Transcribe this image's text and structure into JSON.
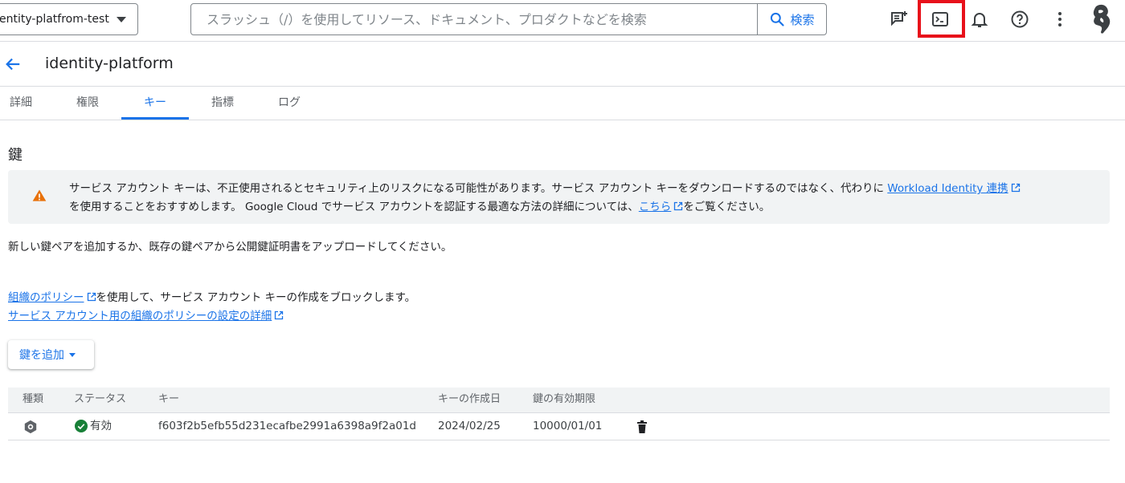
{
  "topbar": {
    "project_name": "entity-platfrom-test",
    "search_placeholder": "スラッシュ（/）を使用してリソース、ドキュメント、プロダクトなどを検索",
    "search_button": "検索"
  },
  "icons": {
    "feedback": "feedback-icon",
    "cloud_shell": "cloud-shell-terminal-icon",
    "notifications": "bell-icon",
    "help": "help-icon",
    "more": "more-vert-icon"
  },
  "colors": {
    "accent": "#1a73e8",
    "highlight": "#e8111a",
    "warning": "#e8710a",
    "status_ok": "#188038"
  },
  "header": {
    "title": "identity-platform"
  },
  "tabs": [
    {
      "label": "詳細"
    },
    {
      "label": "権限"
    },
    {
      "label": "キー"
    },
    {
      "label": "指標"
    },
    {
      "label": "ログ"
    }
  ],
  "active_tab": "キー",
  "section": {
    "title": "鍵"
  },
  "warning": {
    "text1": "サービス アカウント キーは、不正使用されるとセキュリティ上のリスクになる可能性があります。サービス アカウント キーをダウンロードするのではなく、代わりに ",
    "link1": "Workload Identity 連携",
    "text2": "を使用することをおすすめします。 Google Cloud でサービス アカウントを認証する最適な方法の詳細については、",
    "link2": "こちら",
    "text3": "をご覧ください。"
  },
  "description": "新しい鍵ペアを追加するか、既存の鍵ペアから公開鍵証明書をアップロードしてください。",
  "policy": {
    "link1": "組織のポリシー",
    "text1": "を使用して、サービス アカウント キーの作成をブロックします。",
    "link2": "サービス アカウント用の組織のポリシーの設定の詳細"
  },
  "add_key_button": "鍵を追加",
  "table": {
    "headers": [
      "種類",
      "ステータス",
      "キー",
      "キーの作成日",
      "鍵の有効期限"
    ],
    "rows": [
      {
        "type_icon": "key-type-icon",
        "status": "有効",
        "key": "f603f2b5efb55d231ecafbe2991a6398a9f2a01d",
        "created": "2024/02/25",
        "expires": "10000/01/01"
      }
    ]
  }
}
